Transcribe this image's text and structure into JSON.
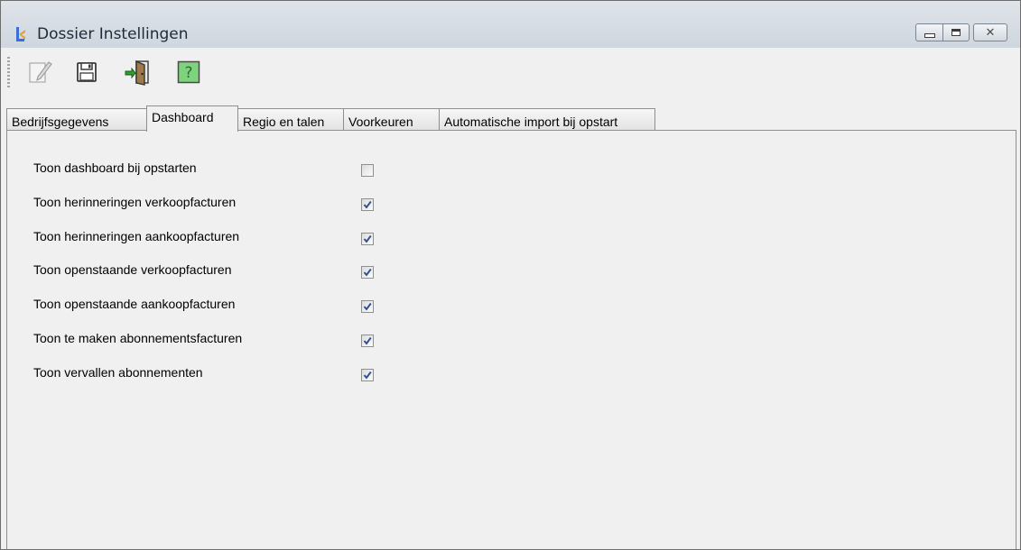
{
  "window": {
    "title": "Dossier Instellingen",
    "controls": [
      "minimize-icon",
      "maximize-icon",
      "close-icon"
    ]
  },
  "toolbar": {
    "buttons": [
      {
        "name": "edit",
        "icon": "edit-icon",
        "enabled": false
      },
      {
        "name": "save",
        "icon": "save-icon",
        "enabled": true
      },
      {
        "name": "exit",
        "icon": "exit-door-icon",
        "enabled": true
      },
      {
        "name": "help",
        "icon": "help-icon",
        "enabled": true
      }
    ]
  },
  "tabs": [
    {
      "label": "Bedrijfsgegevens",
      "active": false
    },
    {
      "label": "Dashboard",
      "active": true
    },
    {
      "label": "Regio en talen",
      "active": false
    },
    {
      "label": "Voorkeuren",
      "active": false
    },
    {
      "label": "Automatische import bij opstart",
      "active": false
    }
  ],
  "options": [
    {
      "label": "Toon dashboard bij opstarten",
      "checked": false
    },
    {
      "label": "Toon herinneringen verkoopfacturen",
      "checked": true
    },
    {
      "label": "Toon herinneringen aankoopfacturen",
      "checked": true
    },
    {
      "label": "Toon openstaande verkoopfacturen",
      "checked": true
    },
    {
      "label": "Toon openstaande aankoopfacturen",
      "checked": true
    },
    {
      "label": "Toon te maken abonnementsfacturen",
      "checked": true
    },
    {
      "label": "Toon vervallen abonnementen",
      "checked": true
    }
  ],
  "colors": {
    "titlebar": "#d6dce3",
    "check": "#2e4f8f",
    "help_bg": "#7fd37f"
  },
  "glyphs": {
    "close": "✕"
  }
}
